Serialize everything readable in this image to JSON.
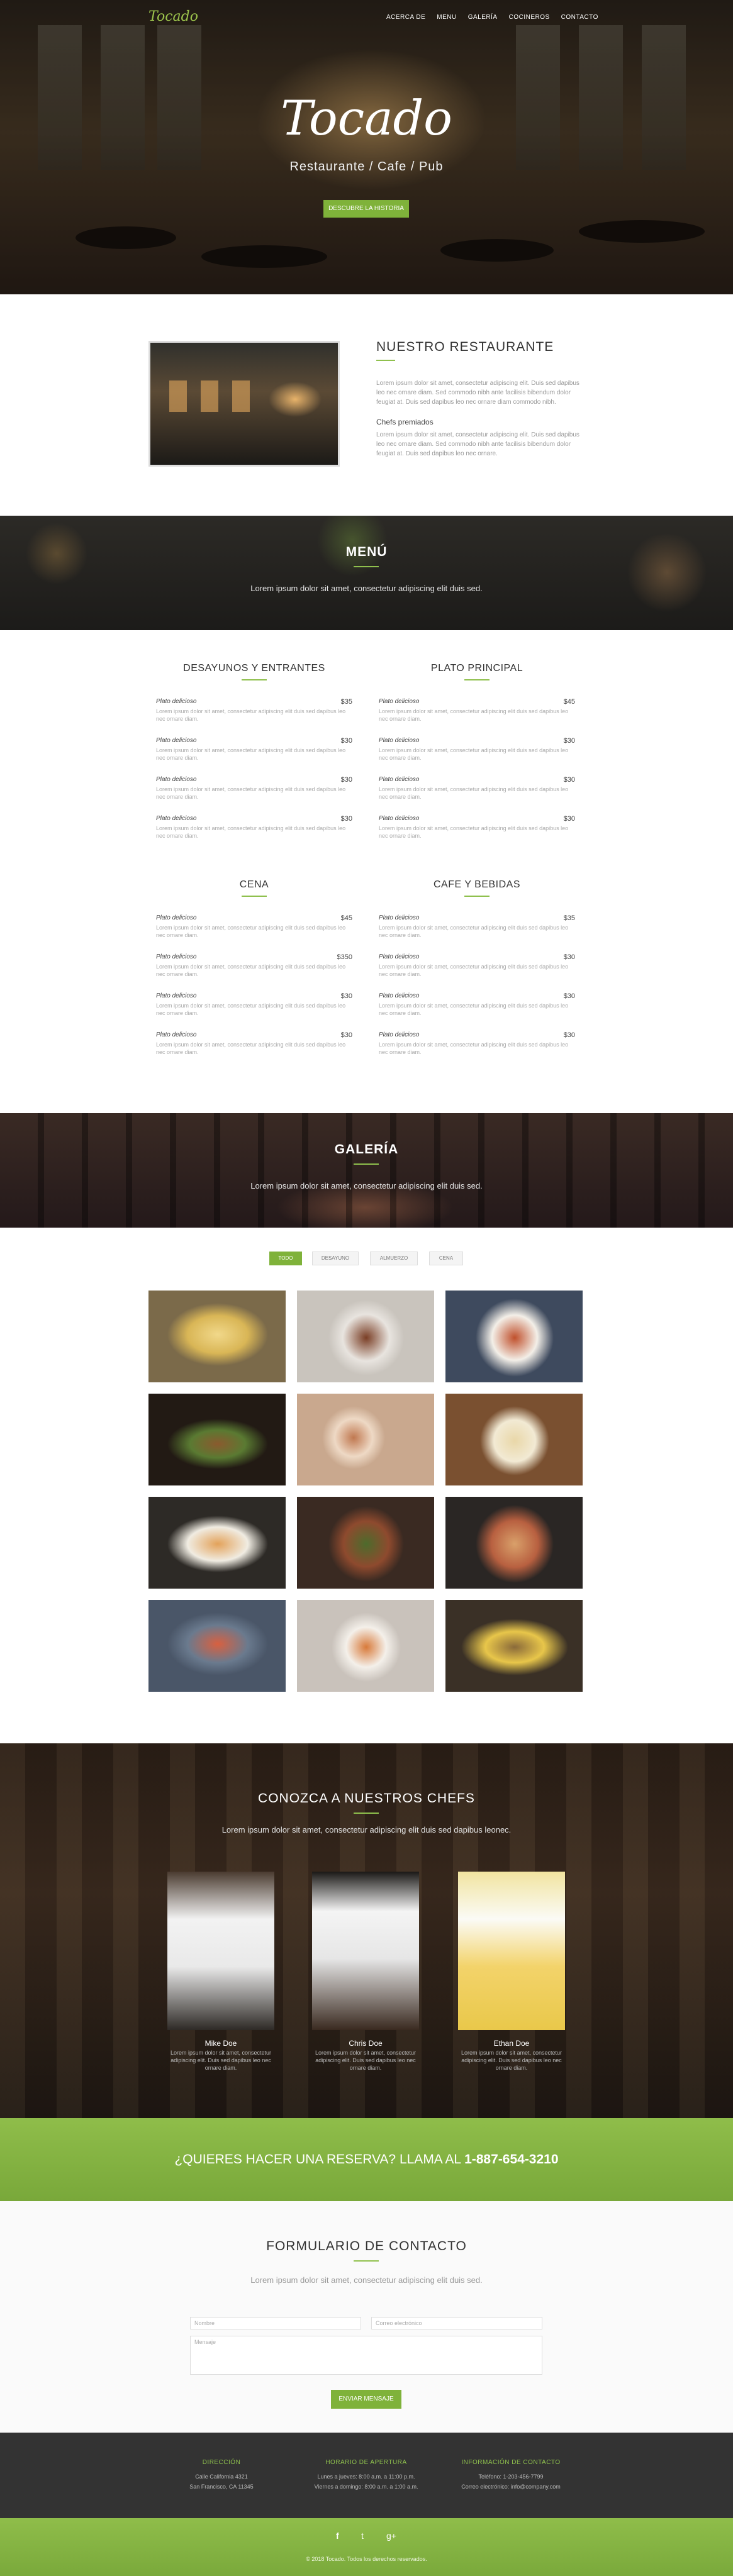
{
  "header": {
    "logo": "Tocado",
    "nav": [
      "ACERCA DE",
      "MENU",
      "GALERÍA",
      "COCINEROS",
      "CONTACTO"
    ]
  },
  "hero": {
    "title": "Tocado",
    "subtitle": "Restaurante / Cafe / Pub",
    "button": "DESCUBRE LA HISTORIA"
  },
  "about": {
    "title": "NUESTRO RESTAURANTE",
    "p1": "Lorem ipsum dolor sit amet, consectetur adipiscing elit. Duis sed dapibus leo nec ornare diam. Sed commodo nibh ante facilisis bibendum dolor feugiat at. Duis sed dapibus leo nec ornare diam commodo nibh.",
    "chefs_title": "Chefs premiados",
    "p2": "Lorem ipsum dolor sit amet, consectetur adipiscing elit. Duis sed dapibus leo nec ornare diam. Sed commodo nibh ante facilisis bibendum dolor feugiat at. Duis sed dapibus leo nec ornare."
  },
  "menu_banner": {
    "title": "MENÚ",
    "subtitle": "Lorem ipsum dolor sit amet, consectetur adipiscing elit duis sed."
  },
  "menu": {
    "item_name": "Plato delicioso",
    "item_desc": "Lorem ipsum dolor sit amet, consectetur adipiscing elit duis sed dapibus leo nec ornare diam.",
    "categories": [
      {
        "title": "DESAYUNOS Y ENTRANTES",
        "prices": [
          "$35",
          "$30",
          "$30",
          "$30"
        ]
      },
      {
        "title": "PLATO PRINCIPAL",
        "prices": [
          "$45",
          "$30",
          "$30",
          "$30"
        ]
      },
      {
        "title": "CENA",
        "prices": [
          "$45",
          "$350",
          "$30",
          "$30"
        ]
      },
      {
        "title": "CAFE Y BEBIDAS",
        "prices": [
          "$35",
          "$30",
          "$30",
          "$30"
        ]
      }
    ]
  },
  "gallery_banner": {
    "title": "GALERÍA",
    "subtitle": "Lorem ipsum dolor sit amet, consectetur adipiscing elit duis sed."
  },
  "gallery": {
    "filters": [
      "TODO",
      "DESAYUNO",
      "ALMUERZO",
      "CENA"
    ]
  },
  "chefs": {
    "title": "CONOZCA A NUESTROS CHEFS",
    "subtitle": "Lorem ipsum dolor sit amet, consectetur adipiscing elit duis sed dapibus leonec.",
    "bio": "Lorem ipsum dolor sit amet, consectetur adipiscing elit. Duis sed dapibus leo nec ornare diam.",
    "people": [
      "Mike Doe",
      "Chris Doe",
      "Ethan Doe"
    ]
  },
  "reserve": {
    "text": "¿QUIERES HACER UNA RESERVA? LLAMA AL ",
    "phone": "1-887-654-3210"
  },
  "contact": {
    "title": "FORMULARIO DE CONTACTO",
    "subtitle": "Lorem ipsum dolor sit amet, consectetur adipiscing elit duis sed.",
    "name_ph": "Nombre",
    "email_ph": "Correo electrónico",
    "message_ph": "Mensaje",
    "button": "ENVIAR MENSAJE"
  },
  "footer": {
    "address_title": "DIRECCIÓN",
    "address": [
      "Calle California 4321",
      "San Francisco, CA 11345"
    ],
    "hours_title": "HORARIO DE APERTURA",
    "hours": [
      "Lunes a jueves: 8:00 a.m. a 11:00 p.m.",
      "Viernes a domingo: 8:00 a.m. a 1:00 a.m."
    ],
    "info_title": "INFORMACIÓN DE CONTACTO",
    "info": [
      "Teléfono: 1-203-456-7799",
      "Correo electrónico: info@company.com"
    ],
    "social": [
      "f",
      "t",
      "g+"
    ],
    "copyright": "© 2018 Tocado. Todos los derechos reservados."
  },
  "colors": {
    "accent": "#7fb23a",
    "dark": "#333333"
  }
}
